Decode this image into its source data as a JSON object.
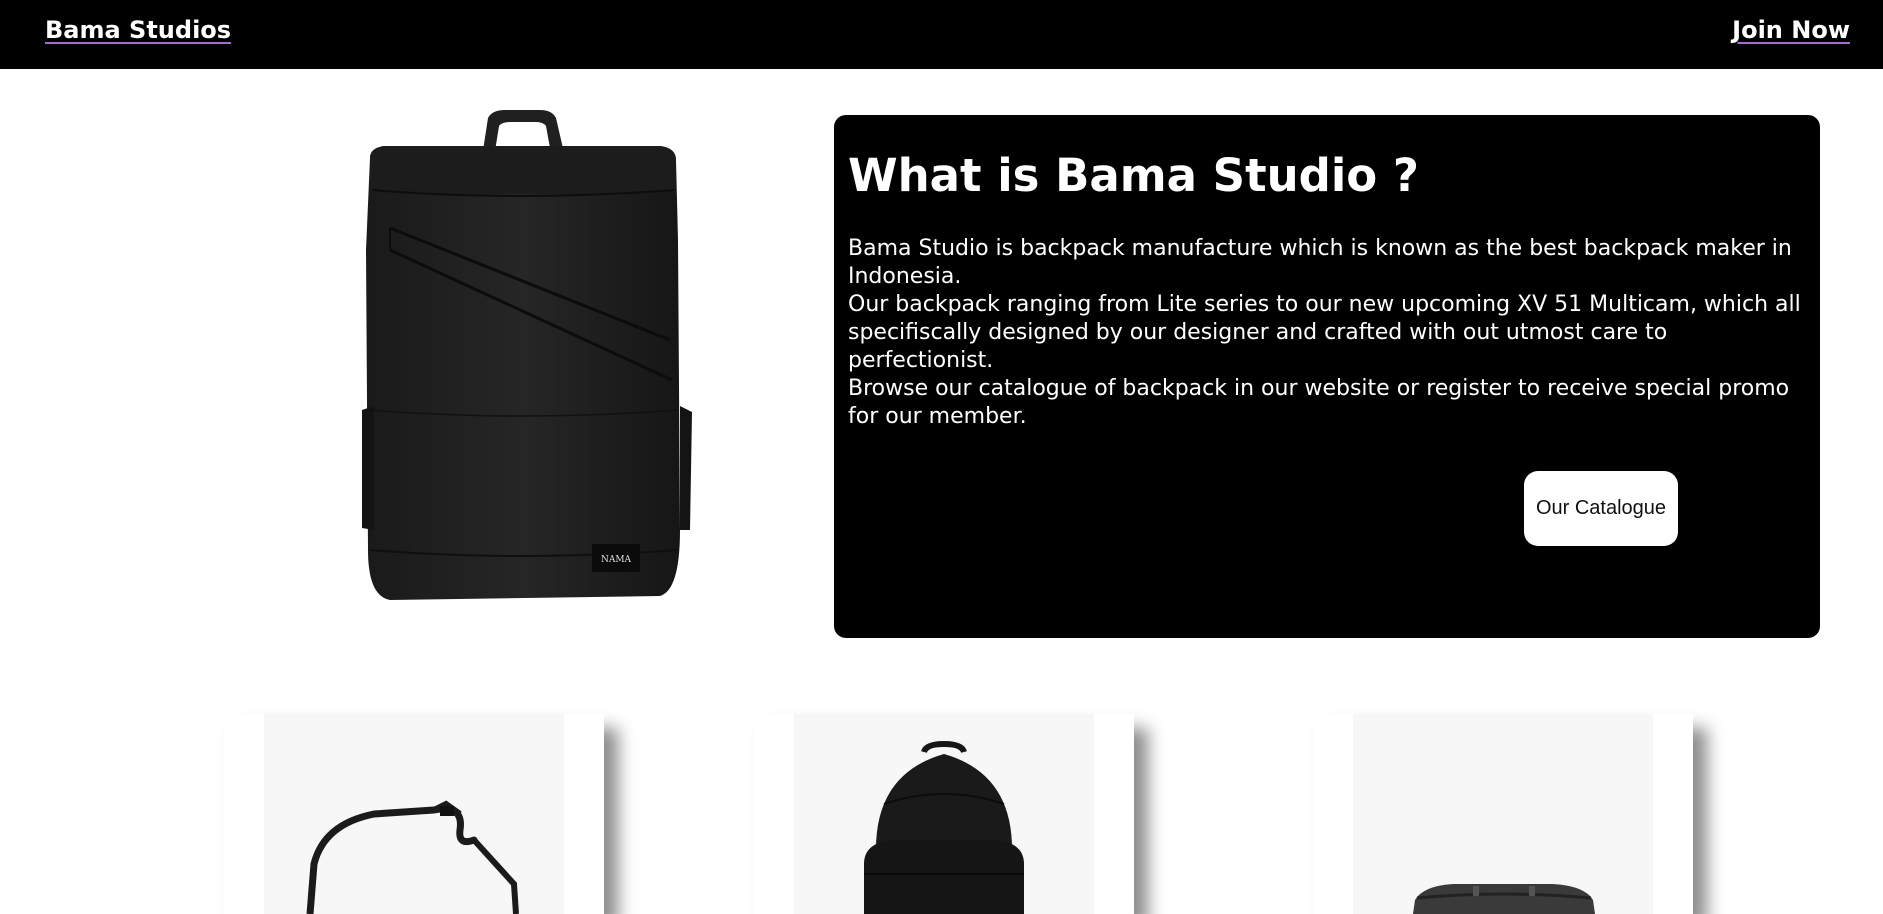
{
  "nav": {
    "brand": "Bama Studios",
    "join": "Join Now"
  },
  "hero": {
    "image_icon": "backpack-icon",
    "badge": "NAMA"
  },
  "info": {
    "title": "What is Bama Studio ?",
    "paragraphs": [
      "Bama Studio is backpack manufacture which is known as the best backpack maker in Indonesia.",
      "Our backpack ranging from Lite series to our new upcoming XV 51 Multicam, which all specifiscally designed by our designer and crafted with out utmost care to perfectionist.",
      "Browse our catalogue of backpack in our website or register to receive special promo for our member."
    ],
    "button": "Our Catalogue"
  },
  "products": [
    {
      "icon": "sling-bag-icon"
    },
    {
      "icon": "backpack-icon"
    },
    {
      "icon": "duffel-bag-icon"
    }
  ],
  "colors": {
    "nav_bg": "#000000",
    "panel_bg": "#000000",
    "text_on_dark": "#ffffff",
    "link_underline": "#a86bd6",
    "button_bg": "#ffffff"
  }
}
